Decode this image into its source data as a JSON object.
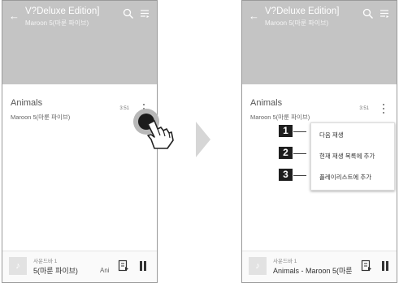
{
  "header": {
    "album_title": "V?Deluxe Edition]",
    "artist": "Maroon 5(마룬 파이브)"
  },
  "icons": {
    "back": "back-arrow-icon",
    "search": "search-icon",
    "queue": "queue-list-icon",
    "more": "kebab-menu-icon",
    "album_art": "music-note-icon",
    "lyrics": "lyrics-icon",
    "pause": "pause-icon",
    "touch": "touch-hand-icon"
  },
  "song": {
    "title": "Animals",
    "artist": "Maroon 5(마룬 파이브)",
    "duration": "3:51"
  },
  "mini_player_left": {
    "source": "사운드바 1",
    "title": "5(마룬 파이브)",
    "next_title_truncated": "Ani"
  },
  "mini_player_right": {
    "source": "사운드바 1",
    "title": "Animals - Maroon 5(마룬"
  },
  "context_menu": {
    "items": [
      {
        "number": "1",
        "label": "다음 재생"
      },
      {
        "number": "2",
        "label": "현재 재생 목록에 추가"
      },
      {
        "number": "3",
        "label": "플레이리스트에 추가"
      }
    ]
  },
  "colors": {
    "header_bg": "#c4c4c4",
    "touch_dot": "#1c1c1c",
    "step_badge": "#1e1e1e"
  }
}
